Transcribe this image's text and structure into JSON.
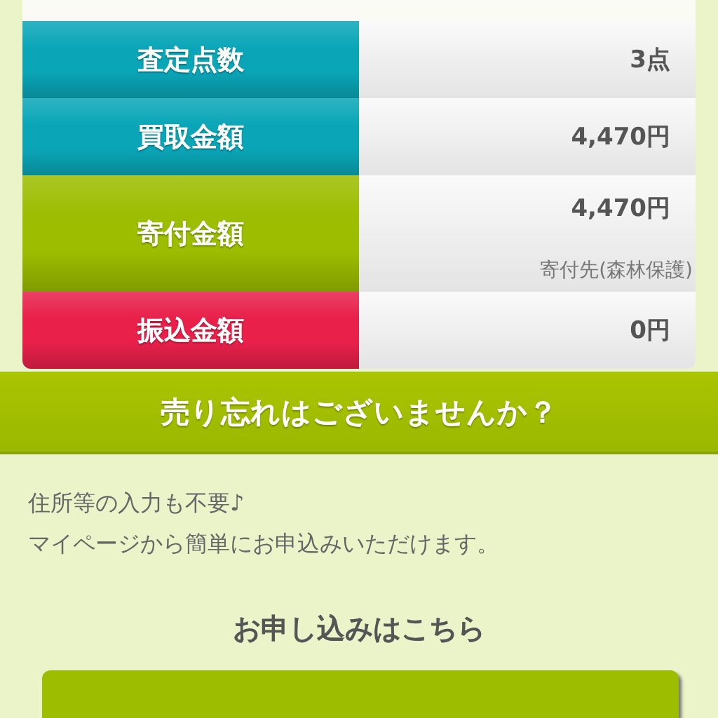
{
  "summary_rows": [
    {
      "label": "査定点数",
      "value": "3点",
      "color": "#0aa6b8"
    },
    {
      "label": "買取金額",
      "value": "4,470円",
      "color": "#0aa6b8"
    },
    {
      "label": "寄付金額",
      "value": "4,470円",
      "note": "寄付先(森林保護)",
      "color": "#9cbd00"
    },
    {
      "label": "振込金額",
      "value": "0円",
      "color": "#e8204a"
    }
  ],
  "section": {
    "title": "売り忘れはございませんか？",
    "description": [
      "住所等の入力も不要♪",
      "マイページから簡単にお申込みいただけます。"
    ],
    "prompt": "お申し込みはこちら"
  }
}
